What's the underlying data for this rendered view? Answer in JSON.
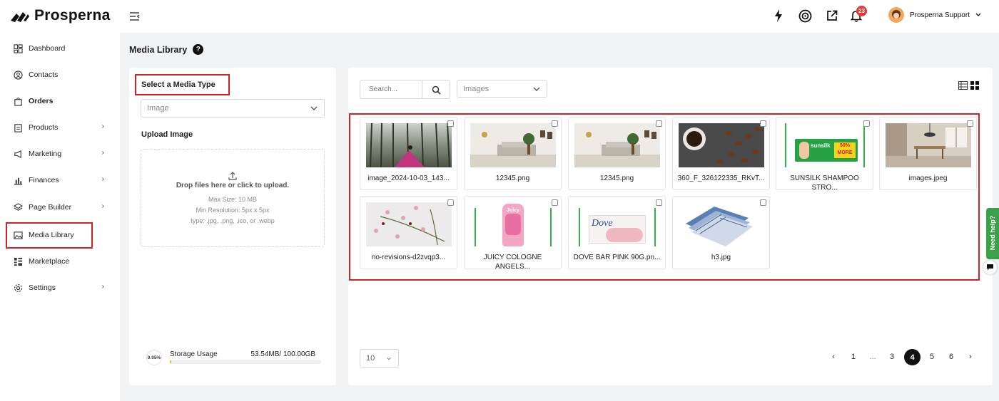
{
  "brand": {
    "name": "Prosperna"
  },
  "sidebar": {
    "items": [
      {
        "label": "Dashboard"
      },
      {
        "label": "Contacts"
      },
      {
        "label": "Orders"
      },
      {
        "label": "Products"
      },
      {
        "label": "Marketing"
      },
      {
        "label": "Finances"
      },
      {
        "label": "Page Builder"
      },
      {
        "label": "Media Library"
      },
      {
        "label": "Marketplace"
      },
      {
        "label": "Settings"
      }
    ]
  },
  "topbar": {
    "notification_count": "23",
    "user_name": "Prosperna Support"
  },
  "page": {
    "title": "Media Library",
    "help_glyph": "?"
  },
  "upload_panel": {
    "media_type_heading": "Select a Media Type",
    "media_type_placeholder": "Image",
    "upload_heading": "Upload Image",
    "drop_text": "Drop files here or click to upload.",
    "max_size": "Max Size: 10 MB",
    "min_resolution": "Min Resolution: 5px x 5px",
    "types": "type: .jpg, .png, .ico, or .webp",
    "storage_label": "Storage Usage",
    "storage_value": "53.54MB/ 100.00GB",
    "storage_percent": "0.05%",
    "storage_fraction": 0.0005
  },
  "library": {
    "search_placeholder": "Search...",
    "filter_value": "Images",
    "items": [
      {
        "name": "image_2024-10-03_143..."
      },
      {
        "name": "12345.png"
      },
      {
        "name": "12345.png"
      },
      {
        "name": "360_F_326122335_RKvT..."
      },
      {
        "name": "SUNSILK SHAMPOO STRO..."
      },
      {
        "name": "images.jpeg"
      },
      {
        "name": "no-revisions-d2zvqp3..."
      },
      {
        "name": "JUICY COLOGNE ANGELS..."
      },
      {
        "name": "DOVE BAR PINK 90G.pn..."
      },
      {
        "name": "h3.jpg"
      }
    ],
    "thumb_text": {
      "sunsilk": "sunsilk",
      "sunsilk_promo": "50% MORE",
      "juicy": "Juicy",
      "dove": "Dove"
    }
  },
  "pagination": {
    "per_page": "10",
    "prev": "‹",
    "next": "›",
    "pages": [
      "1",
      "...",
      "3",
      "4",
      "5",
      "6"
    ],
    "current": "4"
  },
  "feedback": {
    "label": "Need help?"
  },
  "colors": {
    "highlight": "#d62028",
    "badge": "#e53935",
    "feedback": "#3aa14a",
    "active_page": "#111111"
  }
}
